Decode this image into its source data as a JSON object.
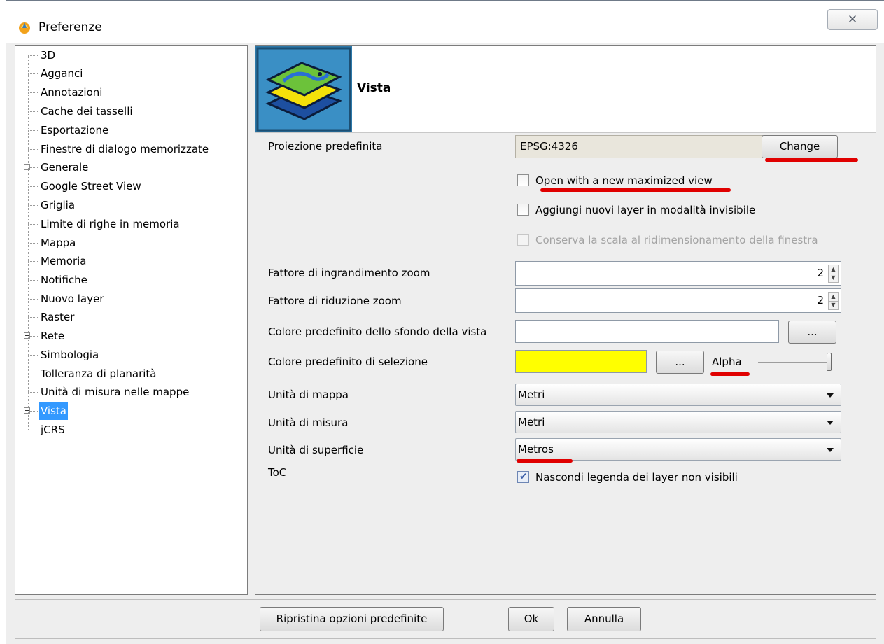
{
  "window": {
    "title": "Preferenze",
    "close_glyph": "✕"
  },
  "tree": {
    "items": [
      {
        "label": "3D",
        "expandable": false
      },
      {
        "label": "Agganci",
        "expandable": false
      },
      {
        "label": "Annotazioni",
        "expandable": false
      },
      {
        "label": "Cache dei tasselli",
        "expandable": false
      },
      {
        "label": "Esportazione",
        "expandable": false
      },
      {
        "label": "Finestre di dialogo memorizzate",
        "expandable": false
      },
      {
        "label": "Generale",
        "expandable": true
      },
      {
        "label": "Google Street View",
        "expandable": false
      },
      {
        "label": "Griglia",
        "expandable": false
      },
      {
        "label": "Limite di righe in memoria",
        "expandable": false
      },
      {
        "label": "Mappa",
        "expandable": false
      },
      {
        "label": "Memoria",
        "expandable": false
      },
      {
        "label": "Notifiche",
        "expandable": false
      },
      {
        "label": "Nuovo layer",
        "expandable": false
      },
      {
        "label": "Raster",
        "expandable": false
      },
      {
        "label": "Rete",
        "expandable": true
      },
      {
        "label": "Simbologia",
        "expandable": false
      },
      {
        "label": "Tolleranza di planarità",
        "expandable": false
      },
      {
        "label": "Unità di misura nelle mappe",
        "expandable": false
      },
      {
        "label": "Vista",
        "expandable": true,
        "selected": true
      },
      {
        "label": "jCRS",
        "expandable": false
      }
    ]
  },
  "panel": {
    "title": "Vista",
    "projection": {
      "label": "Proiezione predefinita",
      "value": "EPSG:4326",
      "change_label": "Change"
    },
    "checkboxes": {
      "open_maximized": {
        "label": "Open with a new maximized  view",
        "checked": false
      },
      "add_invisible": {
        "label": "Aggiungi nuovi layer in modalità invisibile",
        "checked": false
      },
      "keep_scale": {
        "label": "Conserva la scala al ridimensionamento della finestra",
        "checked": false,
        "disabled": true
      }
    },
    "zoom_in": {
      "label": "Fattore di ingrandimento zoom",
      "value": "2"
    },
    "zoom_out": {
      "label": "Fattore di riduzione zoom",
      "value": "2"
    },
    "bg_color": {
      "label": "Colore predefinito dello sfondo della vista",
      "color": "#ffffff",
      "button_label": "..."
    },
    "sel_color": {
      "label": "Colore predefinito di selezione",
      "color": "#ffff00",
      "button_label": "...",
      "alpha_label": "Alpha",
      "alpha_level": 1.0
    },
    "map_units": {
      "label": "Unità di mappa",
      "value": "Metri"
    },
    "measure_units": {
      "label": "Unità di misura",
      "value": "Metri"
    },
    "area_units": {
      "label": "Unità di superficie",
      "value": "Metros"
    },
    "toc": {
      "label": "ToC",
      "checkbox_label": "Nascondi legenda dei layer non visibili",
      "checked": true
    }
  },
  "footer": {
    "reset_label": "Ripristina opzioni predefinite",
    "ok_label": "Ok",
    "cancel_label": "Annulla"
  },
  "colors": {
    "selection": "#3399ff",
    "annotation_red": "#e00000",
    "header_icon_bg": "#2d78a8"
  }
}
